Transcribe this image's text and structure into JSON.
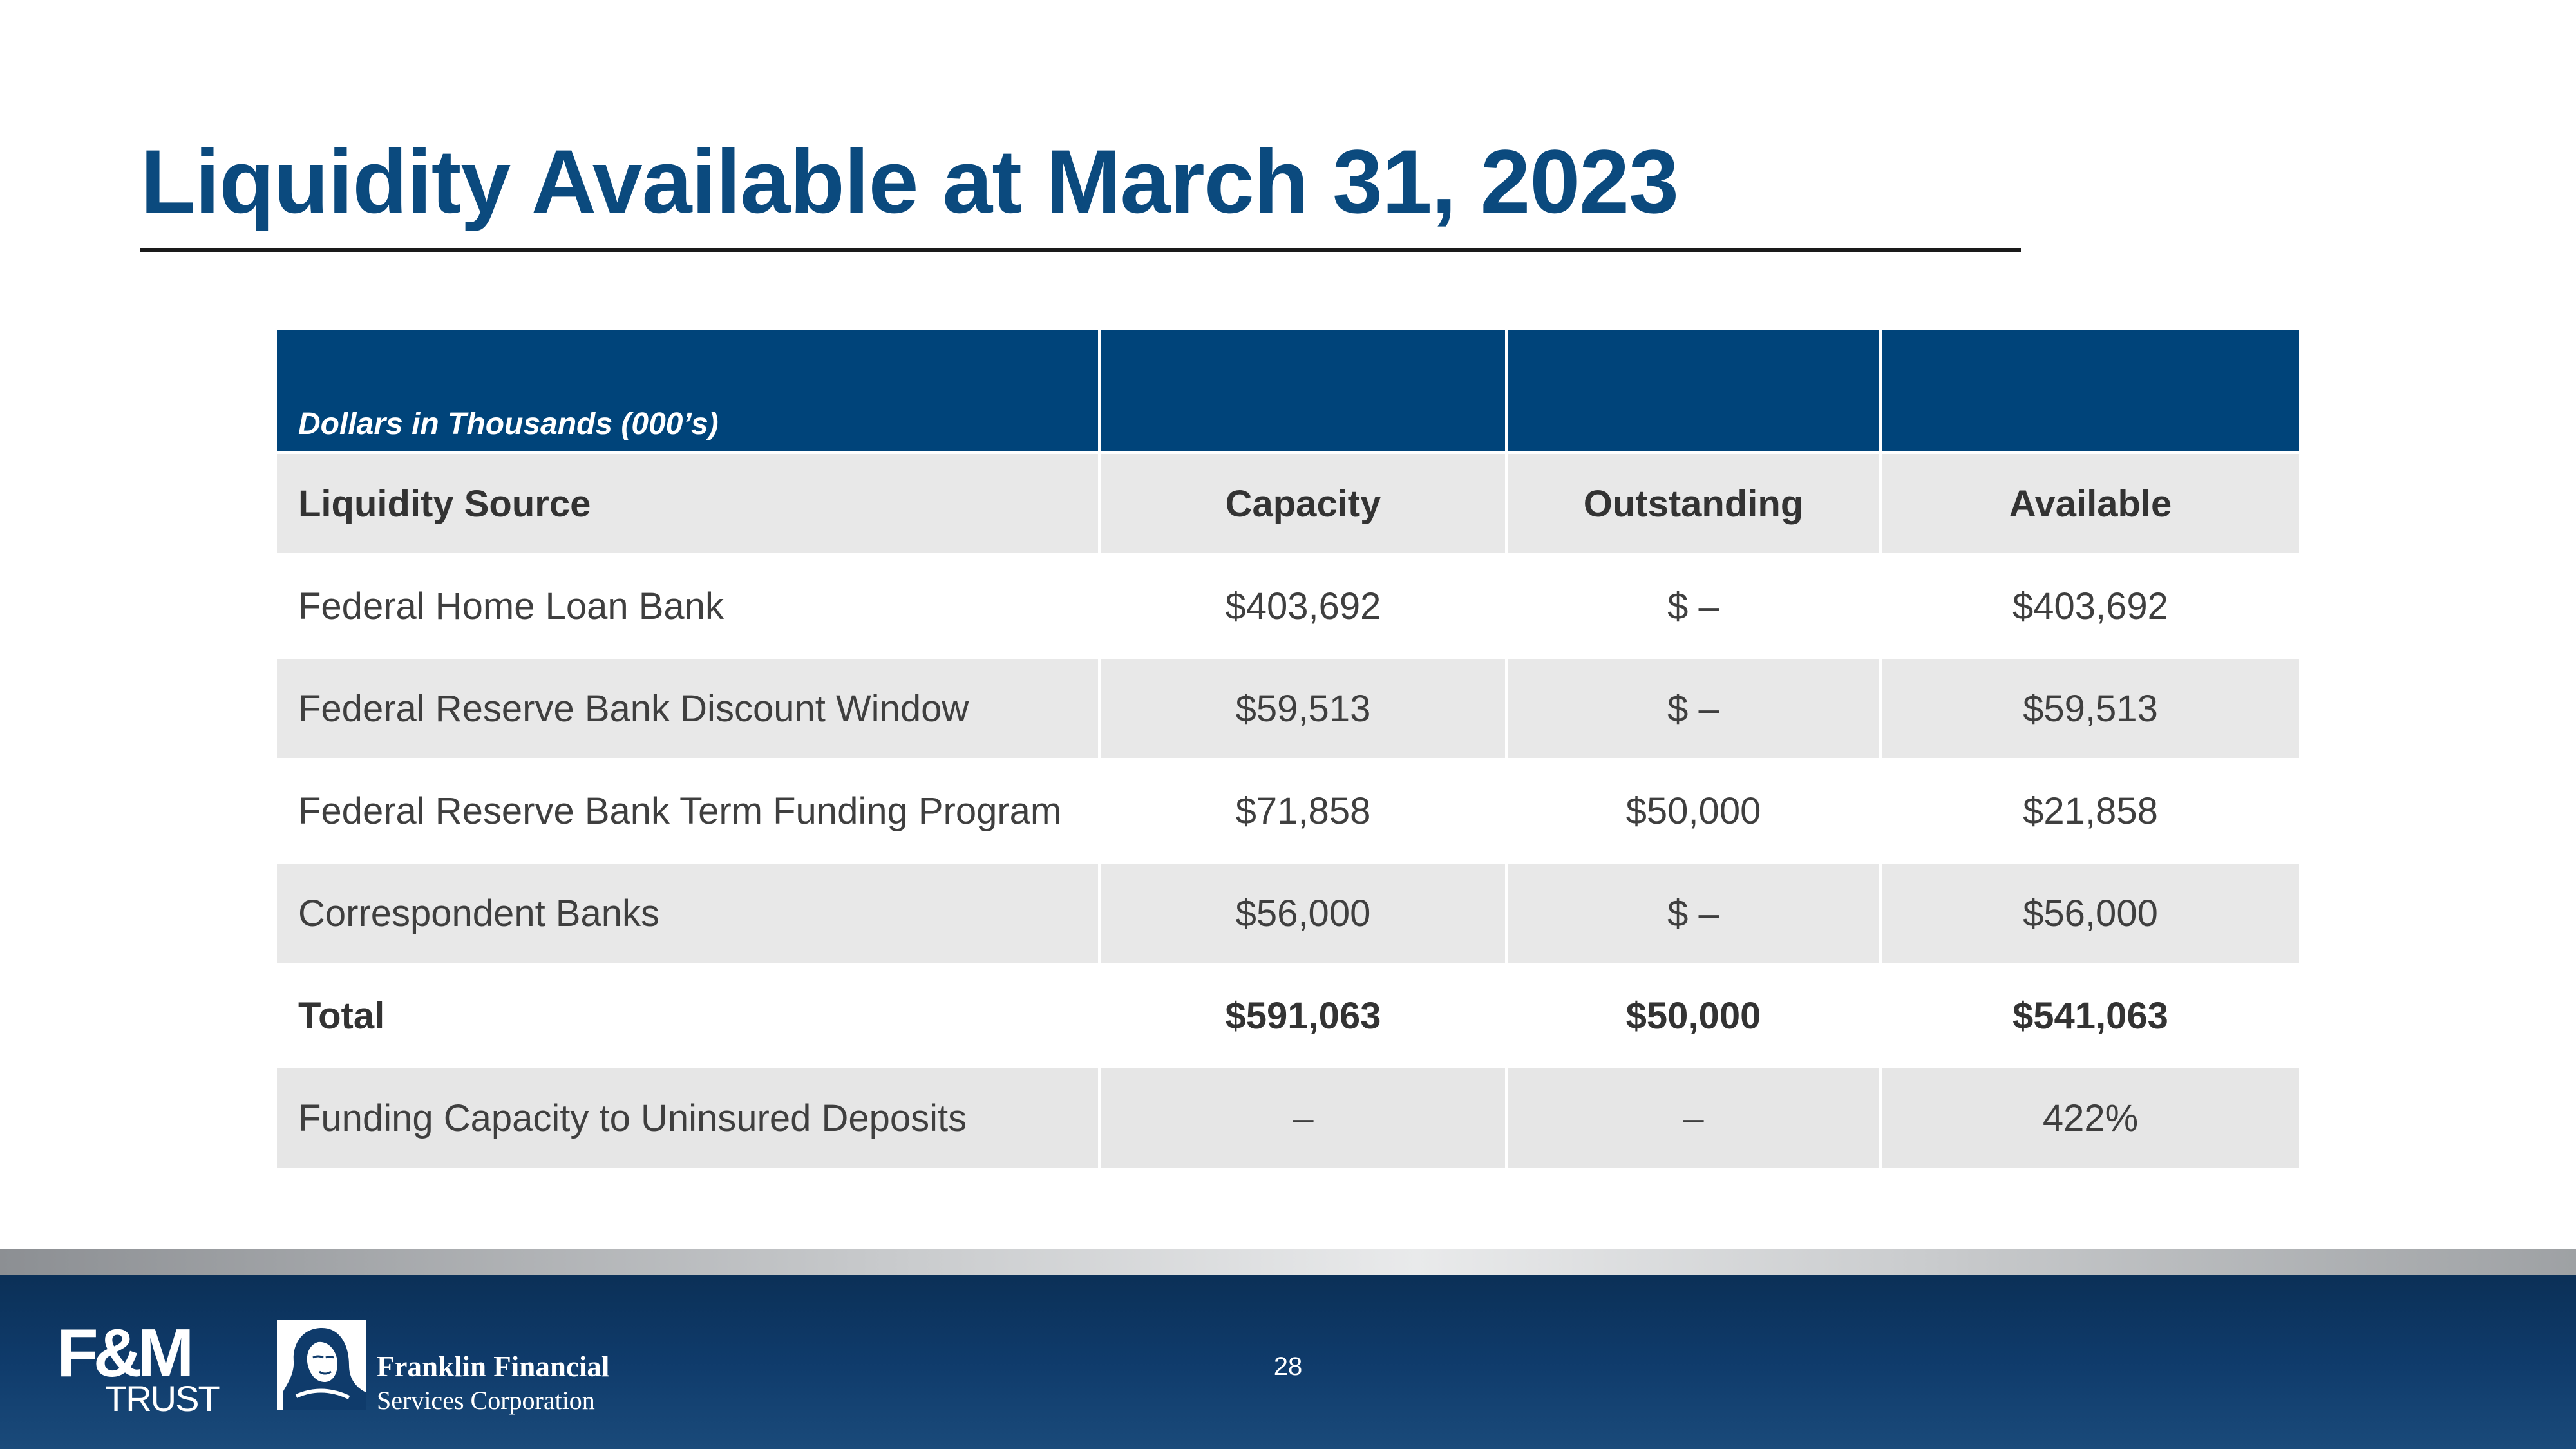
{
  "slide": {
    "title": "Liquidity Available at March 31, 2023",
    "page_number": "28"
  },
  "table": {
    "caption": "Dollars in Thousands (000’s)",
    "columns": [
      "Liquidity Source",
      "Capacity",
      "Outstanding",
      "Available"
    ],
    "rows": [
      [
        "Federal Home Loan Bank",
        "$403,692",
        "$  –",
        "$403,692"
      ],
      [
        "Federal Reserve Bank Discount Window",
        "$59,513",
        "$  –",
        "$59,513"
      ],
      [
        "Federal Reserve Bank Term Funding Program",
        "$71,858",
        "$50,000",
        "$21,858"
      ],
      [
        "Correspondent Banks",
        "$56,000",
        "$  –",
        "$56,000"
      ],
      [
        "Total",
        "$591,063",
        "$50,000",
        "$541,063"
      ],
      [
        "Funding Capacity to Uninsured Deposits",
        "–",
        "–",
        "422%"
      ]
    ]
  },
  "footer": {
    "fm_logo_main": "F&M",
    "fm_logo_sub": "TRUST",
    "company_name": "Franklin Financial",
    "company_sub": "Services Corporation",
    "fm_logo_icon": "fm-trust-logo",
    "ffsc_emblem_icon": "franklin-portrait-emblem"
  },
  "colors": {
    "title_blue": "#0b4a7e",
    "header_blue": "#00447a",
    "row_shade": "#e8e8e8",
    "footer_navy": "#0f3b6b"
  }
}
